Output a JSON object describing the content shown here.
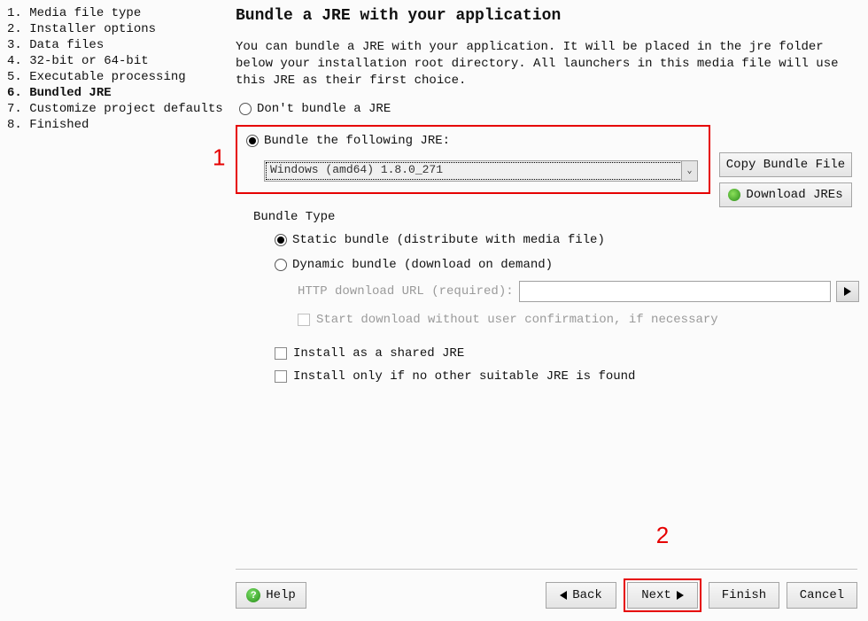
{
  "sidebar": {
    "items": [
      {
        "num": "1.",
        "label": "Media file type"
      },
      {
        "num": "2.",
        "label": "Installer options"
      },
      {
        "num": "3.",
        "label": "Data files"
      },
      {
        "num": "4.",
        "label": "32-bit or 64-bit"
      },
      {
        "num": "5.",
        "label": "Executable processing"
      },
      {
        "num": "6.",
        "label": "Bundled JRE"
      },
      {
        "num": "7.",
        "label": "Customize project defaults"
      },
      {
        "num": "8.",
        "label": "Finished"
      }
    ],
    "active_index": 5
  },
  "page": {
    "title": "Bundle a JRE with your application",
    "intro": "You can bundle a JRE with your application. It will be placed in the jre folder below your installation root directory. All launchers in this media file will use this JRE as their first choice."
  },
  "options": {
    "dont_bundle": "Don't bundle a JRE",
    "bundle_following": "Bundle the following JRE:",
    "jre_value": "Windows (amd64) 1.8.0_271"
  },
  "buttons": {
    "copy_bundle": "Copy Bundle File",
    "download_jres": "Download JREs"
  },
  "bundle_type": {
    "title": "Bundle Type",
    "static": "Static bundle (distribute with media file)",
    "dynamic": "Dynamic bundle (download on demand)",
    "url_label": "HTTP download URL (required):",
    "start_download": "Start download without user confirmation, if necessary",
    "shared": "Install as a shared JRE",
    "only_if": "Install only if no other suitable JRE is found"
  },
  "footer": {
    "help": "Help",
    "back": "Back",
    "next": "Next",
    "finish": "Finish",
    "cancel": "Cancel"
  },
  "annotations": {
    "a1": "1",
    "a2": "2"
  }
}
